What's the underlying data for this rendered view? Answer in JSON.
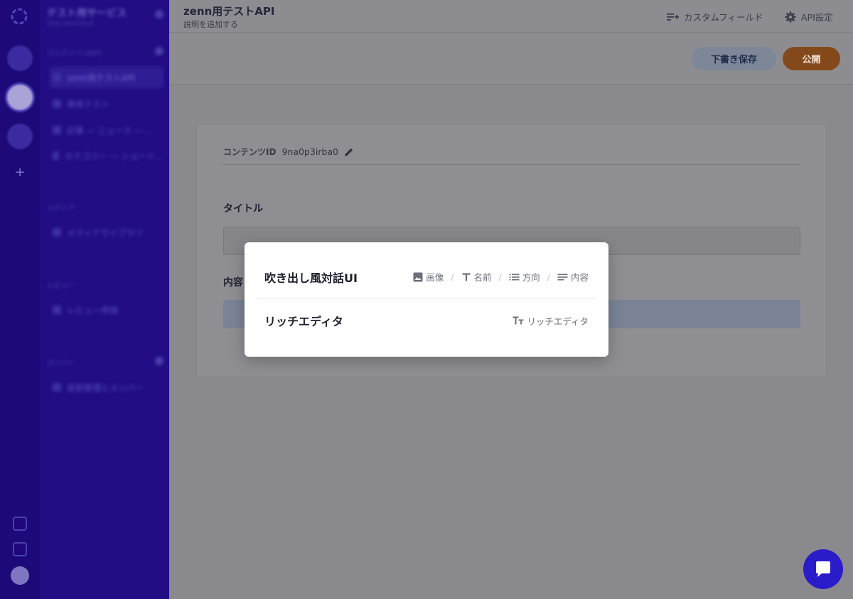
{
  "sidebar": {
    "service_name": "テスト用サービス",
    "service_id": "test-zenntest",
    "sections": [
      {
        "label": "コンテンツ (API)"
      },
      {
        "label": "メディア"
      },
      {
        "label": "レビュー"
      },
      {
        "label": "メンバー"
      }
    ],
    "items": [
      {
        "label": "zenn用テストAPI"
      },
      {
        "label": "単体テスト"
      },
      {
        "label": "記事 — ニュース — ..."
      },
      {
        "label": "カテゴリー — ショート..."
      },
      {
        "label": "メディアライブラリ"
      },
      {
        "label": "レビュー申請"
      },
      {
        "label": "役割管理とメンバー"
      }
    ]
  },
  "header": {
    "api_title": "zenn用テストAPI",
    "api_description": "説明を追加する",
    "custom_field_label": "カスタムフィールド",
    "api_settings_label": "API設定"
  },
  "actions": {
    "draft_label": "下書き保存",
    "publish_label": "公開"
  },
  "form": {
    "content_id_label": "コンテンツID",
    "content_id_value": "9na0p3irba0",
    "title_label": "タイトル",
    "content_label": "内容"
  },
  "modal": {
    "options": [
      {
        "name": "吹き出し風対話UI",
        "fields": [
          {
            "icon": "image-icon",
            "label": "画像"
          },
          {
            "icon": "text-icon",
            "label": "名前"
          },
          {
            "icon": "list-icon",
            "label": "方向"
          },
          {
            "icon": "paragraph-icon",
            "label": "内容"
          }
        ],
        "separator": "/"
      },
      {
        "name": "リッチエディタ",
        "fields": [
          {
            "icon": "rich-text-icon",
            "label": "リッチエディタ"
          }
        ]
      }
    ]
  },
  "colors": {
    "rail": "#1d0a78",
    "sidebar": "#220d85",
    "overlay": "#8a8a8e",
    "modal": "#ffffff",
    "publish": "#84491a",
    "chat": "#2a1cc9"
  }
}
